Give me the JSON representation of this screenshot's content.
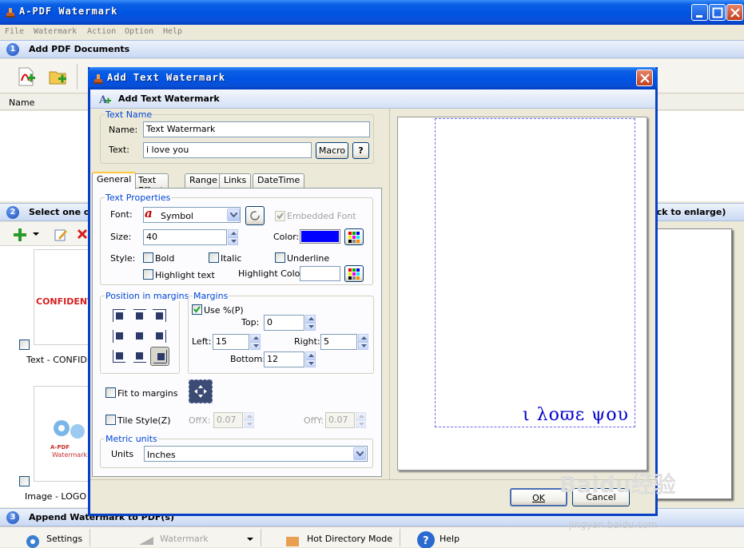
{
  "app": {
    "title": "A-PDF Watermark",
    "menu": [
      "File",
      "Watermark",
      "Action",
      "Option",
      "Help"
    ]
  },
  "steps": {
    "s1": {
      "num": "1",
      "label": "Add PDF Documents"
    },
    "s2": {
      "num": "2",
      "label": "Select one or",
      "right_label": "ick to enlarge)"
    },
    "s3": {
      "num": "3",
      "label": "Append Watermark to PDF(s)"
    }
  },
  "file_list": {
    "column_name": "Name"
  },
  "thumbnails": [
    {
      "text": "CONFIDENT",
      "caption": "Text - CONFIDE"
    },
    {
      "logo_line1": "A-PDF",
      "logo_line2": "Watermark",
      "caption": "Image - LOGO (c"
    }
  ],
  "bottom_toolbar": {
    "settings": "Settings",
    "watermark": "Watermark",
    "hot_directory": "Hot Directory Mode",
    "help": "Help"
  },
  "dialog": {
    "title": "Add Text Watermark",
    "header": "Add Text Watermark",
    "text_name": {
      "group_title": "Text Name",
      "name_label": "Name:",
      "name_value": "Text Watermark",
      "text_label": "Text:",
      "text_value": "i love you",
      "macro_button": "Macro",
      "help_button": "?"
    },
    "tabs": [
      "General",
      "Text Effect",
      "Range",
      "Links",
      "DateTime"
    ],
    "text_properties": {
      "group_title": "Text Properties",
      "font_label": "Font:",
      "font_value": "Symbol",
      "embedded_font": "Embedded Font",
      "size_label": "Size:",
      "size_value": "40",
      "color_label": "Color:",
      "color_value": "#0000ff",
      "style_label": "Style:",
      "bold": "Bold",
      "italic": "Italic",
      "underline": "Underline",
      "highlight_text": "Highlight text",
      "highlight_color_label": "Highlight Color:"
    },
    "position": {
      "group_title": "Position in margins"
    },
    "margins": {
      "group_title": "Margins",
      "use_percent": "Use %(P)",
      "use_percent_checked": true,
      "top_label": "Top:",
      "top_value": "0",
      "left_label": "Left:",
      "left_value": "15",
      "right_label": "Right:",
      "right_value": "5",
      "bottom_label": "Bottom:",
      "bottom_value": "12"
    },
    "fit_to_margins": "Fit to margins",
    "tile_style": {
      "label": "Tile Style(Z)",
      "offx_label": "OffX:",
      "offx_value": "0.07",
      "offy_label": "OffY:",
      "offy_value": "0.07"
    },
    "metric": {
      "group_title": "Metric units",
      "units_label": "Units",
      "units_value": "Inches"
    },
    "preview_text": "ι λοϖε ψου",
    "ok_button": "OK",
    "cancel_button": "Cancel"
  },
  "overlay": {
    "logo": "Baidu经验",
    "url": "jingyan.baidu.com"
  }
}
